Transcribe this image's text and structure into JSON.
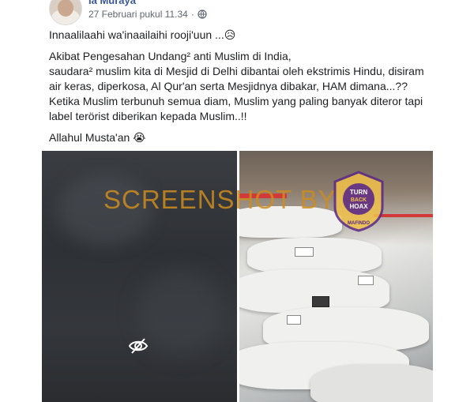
{
  "post": {
    "author": "Ia Muraya",
    "timestamp": "27 Februari pukul 11.34",
    "separator": "·",
    "privacy_icon": "globe-icon",
    "paragraphs": [
      [
        "Innaalilaahi wa'inaailaihi rooji'uun ...😥"
      ],
      [
        "Akibat Pengesahan Undang² anti Muslim di India,",
        "saudara² muslim kita di Mesjid di Delhi dibantai oleh ekstrimis Hindu, disiram",
        "air keras, diperkosa, Al Qur'an serta Mesjidnya dibakar, HAM dimana...??",
        "Ketika Muslim terbunuh semua diam, Muslim yang paling banyak diteror tapi",
        "label terörist diberikan kepada Muslim..!!"
      ],
      [
        "Allahul Musta'an 😭"
      ]
    ]
  },
  "media": {
    "left_image": "hidden-content (sensitive)",
    "hidden_icon": "eye-slash-icon",
    "right_image": "bodies-covered-in-white-cloth"
  },
  "watermark": {
    "text": "SCREENSHOT BY",
    "color": "#cd8c1e",
    "badge_icon": "turnbackhoax-mafindo-badge",
    "badge_lines": [
      "TURN",
      "BACK",
      "HOAX"
    ],
    "badge_bottom": "MAFINDO"
  },
  "colors": {
    "author": "#385898",
    "meta": "#606770",
    "text": "#1c1e21"
  }
}
